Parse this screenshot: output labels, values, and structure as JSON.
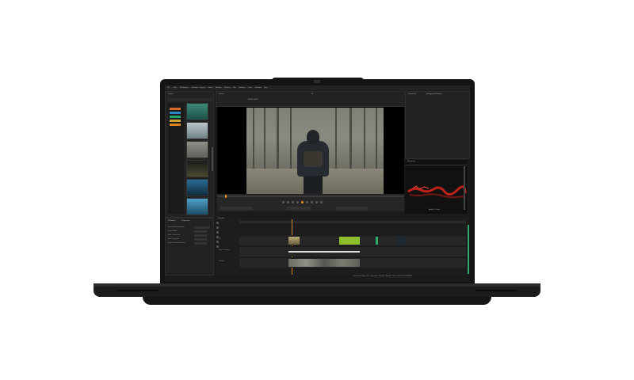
{
  "menu": [
    "File",
    "Edit",
    "Workspace",
    "Window",
    "Graphs",
    "Tracks",
    "Editing",
    "Markers",
    "Mix",
    "Tracking",
    "View",
    "Window",
    "Help"
  ],
  "project_panel": {
    "title": "Project",
    "bins": [
      {
        "color": "#d76b2a"
      },
      {
        "color": "#2c88c4"
      },
      {
        "color": "#23a66c"
      },
      {
        "color": "#cda22e"
      }
    ]
  },
  "viewer": {
    "title": "Viewer",
    "timecode": "00:00:13:05",
    "zoom": "Fit"
  },
  "properties_panel": {
    "tabs": [
      "Properties",
      "Background Masters"
    ]
  },
  "scopes": {
    "title": "Waveform",
    "note": "Audio S. Scale"
  },
  "inspector": {
    "tabs": [
      "Metadata",
      "Properties"
    ],
    "rows": [
      {
        "label": "Sound Normalization"
      },
      {
        "label": "Frame Rate"
      },
      {
        "label": "Start Timecode"
      },
      {
        "label": "End Timecode"
      },
      {
        "label": "Total Timeline Frames"
      }
    ]
  },
  "timeline": {
    "title": "Timeline",
    "tracks": [
      {
        "name": "V1"
      },
      {
        "name": "Text Overlays"
      },
      {
        "name": "Visuals"
      }
    ]
  },
  "status_bar": "Selected Clip(s): 1/1 | Duration | Ready | Render Time (00:00:00:06/24fps)",
  "colors": {
    "bezel": "#141414",
    "ui_bg": "#1b1b1b",
    "accent_orange": "#d8861f",
    "accent_green": "#8cbf2a"
  }
}
